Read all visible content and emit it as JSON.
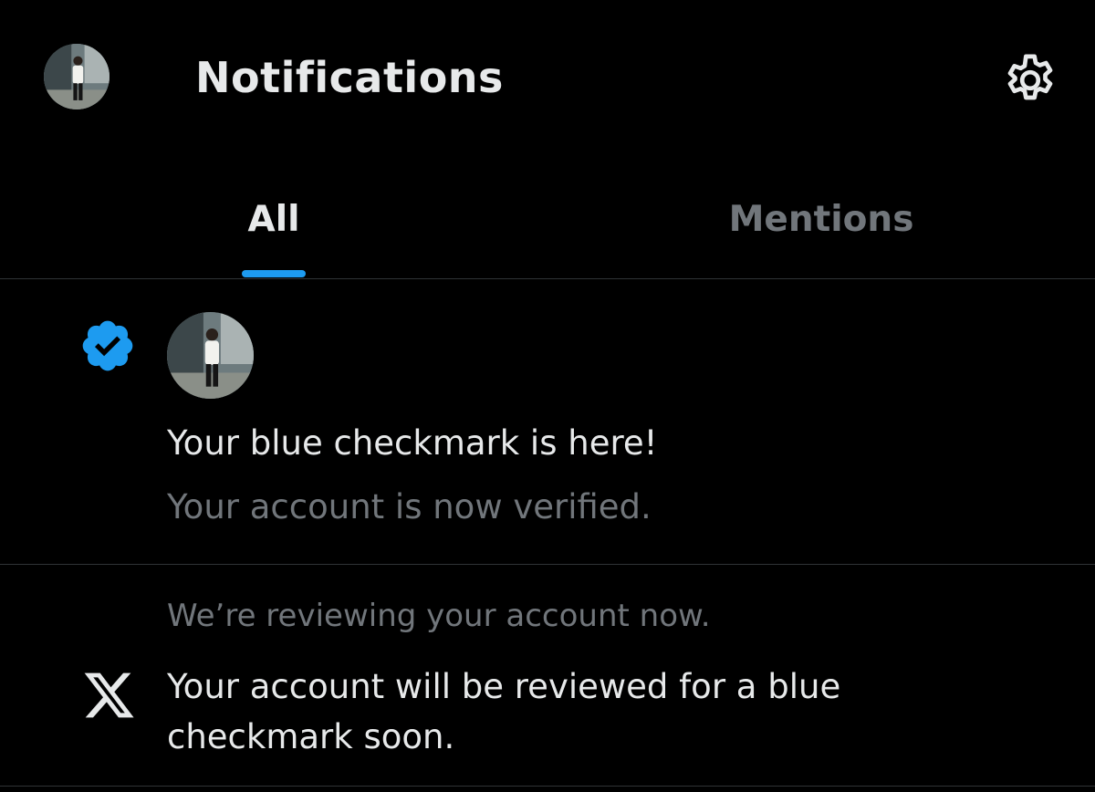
{
  "header": {
    "title": "Notifications",
    "profile_icon": "user-avatar",
    "settings_icon": "gear-icon"
  },
  "tabs": [
    {
      "label": "All",
      "selected": true
    },
    {
      "label": "Mentions",
      "selected": false
    }
  ],
  "notifications": [
    {
      "type": "verification",
      "icon": "verified-badge-icon",
      "icon_color": "#1d9bf0",
      "title": "Your blue checkmark is here!",
      "subtitle": "Your account is now verified."
    },
    {
      "type": "system",
      "icon": "x-logo-icon",
      "preface": "We’re reviewing your account now.",
      "body": "Your account will be reviewed for a blue checkmark soon."
    }
  ],
  "colors": {
    "background": "#000000",
    "primary_text": "#e7e9ea",
    "secondary_text": "#71767b",
    "accent": "#1d9bf0",
    "divider": "#2f3336"
  }
}
